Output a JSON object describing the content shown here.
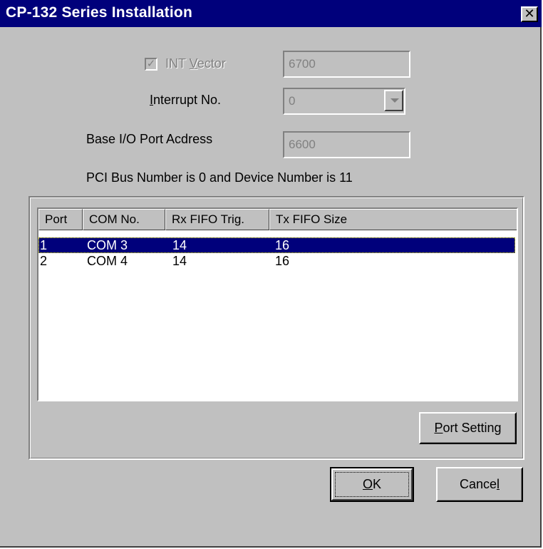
{
  "window": {
    "title": "CP-132 Series Installation",
    "close_glyph": "✕"
  },
  "int_vector": {
    "checked": true,
    "label_prefix": "INT ",
    "label_accel": "V",
    "label_rest": "ector",
    "value": "6700"
  },
  "interrupt": {
    "label_accel": "I",
    "label_rest": "nterrupt No.",
    "value": "0"
  },
  "base_io": {
    "label": "Base I/O Port Acdress",
    "value": "6600"
  },
  "pci_info": "PCI Bus Number is 0 and Device Number is 11",
  "port_table": {
    "columns": [
      "Port",
      "COM No.",
      "Rx FIFO Trig.",
      "Tx FIFO Size"
    ],
    "rows": [
      {
        "port": "1",
        "com": "COM 3",
        "rx": "14",
        "tx": "16",
        "selected": true
      },
      {
        "port": "2",
        "com": "COM 4",
        "rx": "14",
        "tx": "16",
        "selected": false
      }
    ]
  },
  "buttons": {
    "port_setting_accel": "P",
    "port_setting_rest": "ort Setting",
    "ok_accel": "O",
    "ok_rest": "K",
    "cancel_prefix": "Cance",
    "cancel_accel": "l"
  },
  "colors": {
    "face": "#c0c0c0",
    "title_bg": "#00007b",
    "selection_bg": "#00007b",
    "disabled_text": "#808080"
  },
  "icons": {
    "close": "close-icon",
    "dropdown": "chevron-down-icon",
    "check": "checkmark-icon"
  }
}
